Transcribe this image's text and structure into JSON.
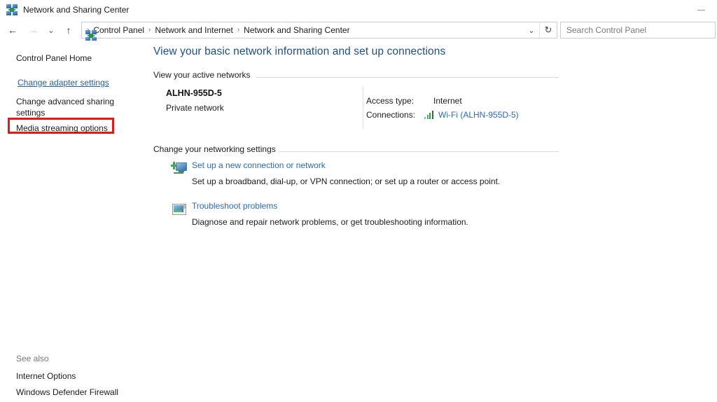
{
  "window": {
    "title": "Network and Sharing Center",
    "icon": "network-sharing-icon",
    "minimize_label": "—"
  },
  "navbar": {
    "back_icon": "←",
    "forward_icon": "→",
    "recent_icon": "⌄",
    "up_icon": "↑",
    "address_icon": "network-sharing-icon",
    "breadcrumbs": [
      "Control Panel",
      "Network and Internet",
      "Network and Sharing Center"
    ],
    "separator": "›",
    "dropdown_icon": "⌄",
    "refresh_icon": "↻",
    "search": {
      "placeholder": "Search Control Panel",
      "value": ""
    }
  },
  "sidebar": {
    "home_label": "Control Panel Home",
    "highlighted_link": "Change adapter settings",
    "links": [
      "Change advanced sharing settings",
      "Media streaming options"
    ],
    "highlight_color": "#e01b1b",
    "see_also": {
      "heading": "See also",
      "items": [
        "Internet Options",
        "Windows Defender Firewall"
      ]
    }
  },
  "main": {
    "heading": "View your basic network information and set up connections",
    "heading_color": "#1c4f87",
    "active_networks": {
      "section_title": "View your active networks",
      "network_name": "ALHN-955D-5",
      "network_type": "Private network",
      "access_type_label": "Access type:",
      "access_type_value": "Internet",
      "connections_label": "Connections:",
      "connection_link": "Wi-Fi (ALHN-955D-5)",
      "connection_icon": "wifi-signal-icon"
    },
    "networking_settings": {
      "section_title": "Change your networking settings",
      "items": [
        {
          "icon": "new-connection-icon",
          "link": "Set up a new connection or network",
          "description": "Set up a broadband, dial-up, or VPN connection; or set up a router or access point."
        },
        {
          "icon": "troubleshoot-icon",
          "link": "Troubleshoot problems",
          "description": "Diagnose and repair network problems, or get troubleshooting information."
        }
      ]
    }
  }
}
